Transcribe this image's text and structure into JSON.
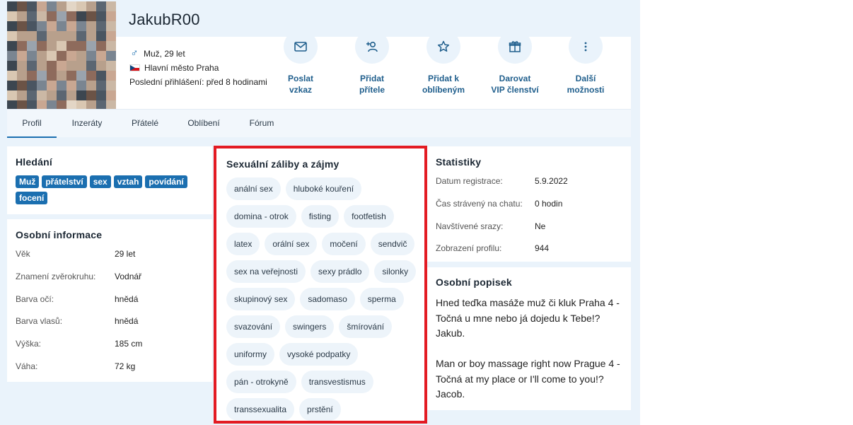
{
  "profile": {
    "username": "JakubR00",
    "gender_age": "Muž, 29 let",
    "gender_icon": "male-icon",
    "location": "Hlavní město Praha",
    "flag_icon": "czech-flag-icon",
    "last_login": "Poslední přihlášení: před 8 hodinami"
  },
  "actions": [
    {
      "icon": "envelope-icon",
      "label": "Poslat\nvzkaz"
    },
    {
      "icon": "add-user-icon",
      "label": "Přidat\npřítele"
    },
    {
      "icon": "star-icon",
      "label": "Přidat k\noblíbeným"
    },
    {
      "icon": "gift-icon",
      "label": "Darovat\nVIP členství"
    },
    {
      "icon": "more-vertical-icon",
      "label": "Další\nmožnosti"
    }
  ],
  "tabs": [
    "Profil",
    "Inzeráty",
    "Přátelé",
    "Oblíbení",
    "Fórum"
  ],
  "active_tab": "Profil",
  "search": {
    "title": "Hledání",
    "tags": [
      "Muž",
      "přátelství",
      "sex",
      "vztah",
      "povídání",
      "focení"
    ]
  },
  "personal_info": {
    "title": "Osobní informace",
    "rows": [
      {
        "key": "Věk",
        "value": "29 let"
      },
      {
        "key": "Znamení zvěrokruhu:",
        "value": "Vodnář"
      },
      {
        "key": "Barva očí:",
        "value": "hnědá"
      },
      {
        "key": "Barva vlasů:",
        "value": "hnědá"
      },
      {
        "key": "Výška:",
        "value": "185 cm"
      },
      {
        "key": "Váha:",
        "value": "72 kg"
      }
    ]
  },
  "interests": {
    "title": "Sexuální záliby a zájmy",
    "items": [
      "anální sex",
      "hluboké kouření",
      "domina - otrok",
      "fisting",
      "footfetish",
      "latex",
      "orální sex",
      "močení",
      "sendvič",
      "sex na veřejnosti",
      "sexy prádlo",
      "silonky",
      "skupinový sex",
      "sadomaso",
      "sperma",
      "svazování",
      "swingers",
      "šmírování",
      "uniformy",
      "vysoké podpatky",
      "pán - otrokyně",
      "transvestismus",
      "transsexualita",
      "prstění"
    ]
  },
  "stats": {
    "title": "Statistiky",
    "rows": [
      {
        "key": "Datum registrace:",
        "value": "5.9.2022"
      },
      {
        "key": "Čas strávený na chatu:",
        "value": "0 hodin"
      },
      {
        "key": "Navštívené srazy:",
        "value": "Ne"
      },
      {
        "key": "Zobrazení profilu:",
        "value": "944"
      }
    ]
  },
  "bio": {
    "title": "Osobní popisek",
    "text": "Hned teďka masáže muž či kluk Praha 4 - Točná u mne nebo já dojedu k Tebe!? Jakub.\n\nMan or boy massage right now Prague 4 - Točná at my place or I'll come to you!? Jacob."
  },
  "colors": {
    "accent": "#1b6fb0",
    "highlight_border": "#e31b23",
    "page_background": "#eaf3fb"
  }
}
